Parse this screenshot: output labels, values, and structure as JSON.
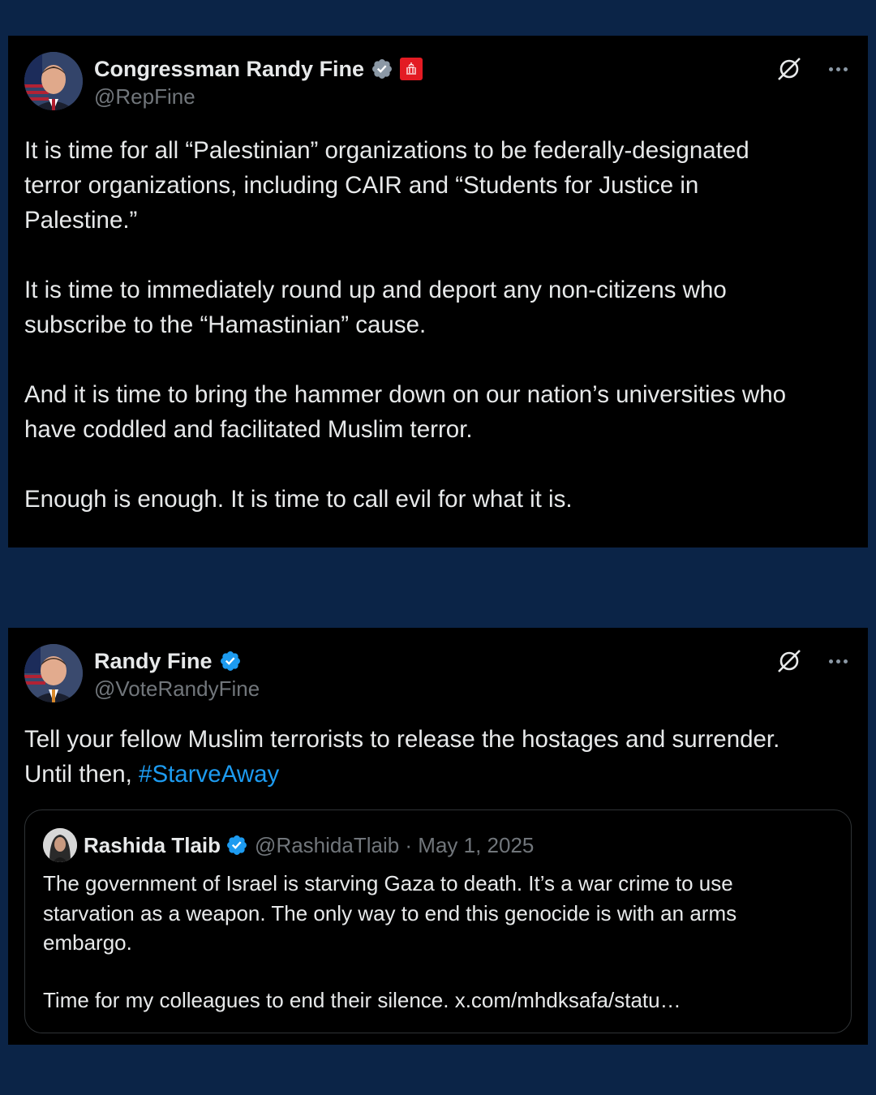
{
  "tweet1": {
    "name": "Congressman Randy Fine",
    "handle": "@RepFine",
    "badge_color": "#8b98a5",
    "affiliation_color": "#e31b23",
    "paragraphs": [
      [
        "It is time for all “Palestinian” organizations to be federally-designated",
        "terror organizations, including CAIR and “Students for Justice in",
        "Palestine.”"
      ],
      [
        "It is time to immediately round up and deport any non-citizens who",
        "subscribe to the “Hamastinian” cause."
      ],
      [
        "And it is time to bring the hammer down on our nation’s universities who",
        "have coddled and facilitated Muslim terror."
      ],
      [
        "Enough is enough.  It is time to call evil for what it is."
      ]
    ]
  },
  "tweet2": {
    "name": "Randy Fine",
    "handle": "@VoteRandyFine",
    "badge_color": "#1d9bf0",
    "line1": "Tell your fellow Muslim terrorists to release the hostages and surrender.",
    "line2_prefix": "Until then, ",
    "hashtag": "#StarveAway",
    "quote": {
      "name": "Rashida Tlaib",
      "handle_date": "@RashidaTlaib · May 1, 2025",
      "lines1": [
        "The government of Israel is starving  Gaza to death. It’s a war crime to use",
        "starvation as a weapon. The only way to end this genocide is with an arms",
        "embargo."
      ],
      "lines2": [
        "Time for my colleagues to end their silence. x.com/mhdksafa/statu…"
      ]
    }
  },
  "colors": {
    "background": "#0b2447",
    "card": "#000000",
    "link": "#1d9bf0",
    "muted": "#71767b"
  },
  "icons": [
    "verified-badge-icon",
    "grok-icon",
    "more-icon",
    "affiliation-icon"
  ]
}
